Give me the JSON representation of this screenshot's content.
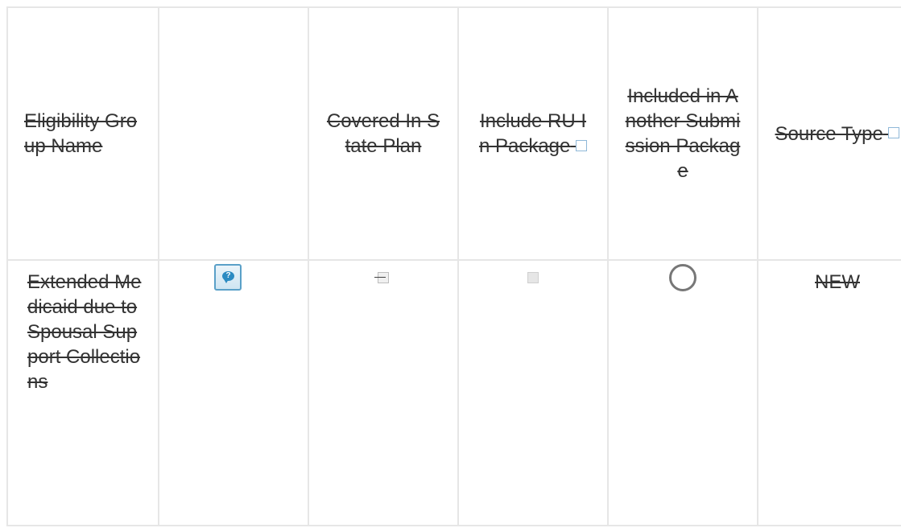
{
  "table": {
    "headers": {
      "eligibility_group_name": "Eligibility Group Name",
      "blank": "",
      "covered_in_state_plan": "Covered In State Plan",
      "include_ru_in_package": "Include RU In Package",
      "included_in_another_submission_package": "Included in Another Submission Package",
      "source_type": "Source Type"
    },
    "rows": [
      {
        "eligibility_group_name": "Extended Medicaid due to Spousal Support Collections",
        "help_icon": "help-bubble-icon",
        "covered_in_state_plan": "checked-disabled",
        "include_ru_in_package": "unchecked-disabled",
        "included_in_another_submission_package": "unselected-radio",
        "source_type": "NEW"
      }
    ]
  },
  "colors": {
    "text": "#333333",
    "border": "#e6e6e6",
    "icon_accent": "#2c8bc2"
  }
}
